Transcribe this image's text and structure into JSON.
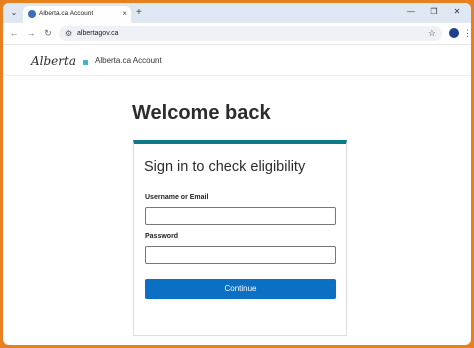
{
  "browser": {
    "tab_title": "Alberta.ca Account",
    "tab_close": "×",
    "new_tab": "+",
    "tab_menu": "⌄",
    "url": "albertagov.ca",
    "controls": {
      "minimize": "—",
      "restore": "❐",
      "close": "✕"
    },
    "nav": {
      "back": "←",
      "forward": "→",
      "reload": "↻"
    },
    "site_info_icon": "⚙",
    "bookmark_icon": "☆",
    "menu_icon": "⋮"
  },
  "header": {
    "logo_text": "Alberta",
    "site_title": "Alberta.ca Account"
  },
  "main": {
    "heading": "Welcome back",
    "card": {
      "title": "Sign in to check eligibility",
      "username_label": "Username or Email",
      "username_value": "",
      "password_label": "Password",
      "password_value": "",
      "continue_label": "Continue"
    }
  },
  "colors": {
    "outer_border": "#e8801f",
    "accent_bar": "#0c7a87",
    "primary_button": "#0b6fc4",
    "logo_mark": "#44b5c7"
  }
}
